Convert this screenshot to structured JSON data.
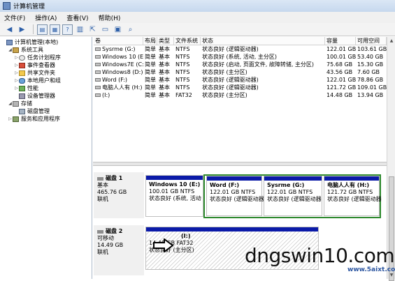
{
  "window": {
    "title": "计算机管理"
  },
  "menu": [
    "文件(F)",
    "操作(A)",
    "查看(V)",
    "帮助(H)"
  ],
  "toolbar": [
    {
      "icon": "back-arrow-icon",
      "glyph": "◀"
    },
    {
      "icon": "forward-arrow-icon",
      "glyph": "▶"
    },
    {
      "icon": "folder-up-icon",
      "glyph": "▤"
    },
    {
      "icon": "console-tree-icon",
      "glyph": "▦"
    },
    {
      "icon": "help-icon",
      "glyph": "?"
    },
    {
      "icon": "list-view-icon",
      "glyph": "▥"
    },
    {
      "icon": "export-icon",
      "glyph": "⇱"
    },
    {
      "icon": "folder-open-icon",
      "glyph": "▭"
    },
    {
      "icon": "properties-icon",
      "glyph": "▣"
    },
    {
      "icon": "search-icon",
      "glyph": "⌕"
    }
  ],
  "tree": [
    {
      "label": "计算机管理(本地)",
      "level": 0,
      "expander": "",
      "icon": "computer-icon",
      "cls": "comp"
    },
    {
      "label": "系统工具",
      "level": 1,
      "expander": "◢",
      "icon": "tools-icon",
      "cls": "tool"
    },
    {
      "label": "任务计划程序",
      "level": 2,
      "expander": "▷",
      "icon": "clock-icon",
      "cls": "clock"
    },
    {
      "label": "事件查看器",
      "level": 2,
      "expander": "▷",
      "icon": "event-log-icon",
      "cls": "log"
    },
    {
      "label": "共享文件夹",
      "level": 2,
      "expander": "▷",
      "icon": "shared-folder-icon",
      "cls": "folder"
    },
    {
      "label": "本地用户和组",
      "level": 2,
      "expander": "▷",
      "icon": "users-icon",
      "cls": "users"
    },
    {
      "label": "性能",
      "level": 2,
      "expander": "▷",
      "icon": "performance-icon",
      "cls": "perf"
    },
    {
      "label": "设备管理器",
      "level": 2,
      "expander": "",
      "icon": "device-manager-icon",
      "cls": "device"
    },
    {
      "label": "存储",
      "level": 1,
      "expander": "◢",
      "icon": "storage-icon",
      "cls": "store"
    },
    {
      "label": "磁盘管理",
      "level": 2,
      "expander": "",
      "icon": "disk-management-icon",
      "cls": "disk"
    },
    {
      "label": "服务和应用程序",
      "level": 1,
      "expander": "▷",
      "icon": "services-icon",
      "cls": "svc"
    }
  ],
  "columns": [
    "卷",
    "布局",
    "类型",
    "文件系统",
    "状态",
    "容量",
    "可用空间"
  ],
  "volumes": [
    [
      "Sysrme (G:)",
      "简单",
      "基本",
      "NTFS",
      "状态良好 (逻辑驱动器)",
      "122.01 GB",
      "103.61 GB"
    ],
    [
      "Windows 10 (E:)",
      "简单",
      "基本",
      "NTFS",
      "状态良好 (系统, 活动, 主分区)",
      "100.01 GB",
      "53.40 GB"
    ],
    [
      "Windows7E (C:)",
      "简单",
      "基本",
      "NTFS",
      "状态良好 (启动, 页面文件, 故障转储, 主分区)",
      "75.68 GB",
      "15.30 GB"
    ],
    [
      "Windows8 (D:)",
      "简单",
      "基本",
      "NTFS",
      "状态良好 (主分区)",
      "43.56 GB",
      "7.60 GB"
    ],
    [
      "Word (F:)",
      "简单",
      "基本",
      "NTFS",
      "状态良好 (逻辑驱动器)",
      "122.01 GB",
      "78.86 GB"
    ],
    [
      "电脑人人有 (H:)",
      "简单",
      "基本",
      "NTFS",
      "状态良好 (逻辑驱动器)",
      "121.72 GB",
      "109.01 GB"
    ],
    [
      "(I:)",
      "简单",
      "基本",
      "FAT32",
      "状态良好 (主分区)",
      "14.48 GB",
      "13.94 GB"
    ]
  ],
  "disks": [
    {
      "name": "磁盘 1",
      "type": "基本",
      "size": "465.76 GB",
      "status": "联机",
      "partitions": [
        {
          "name": "Windows 10  (E:)",
          "fs": "100.01 GB NTFS",
          "status": "状态良好 (系统, 活动"
        },
        {
          "name": "Word  (F:)",
          "fs": "122.01 GB NTFS",
          "status": "状态良好 (逻辑驱动器"
        },
        {
          "name": "Sysrme  (G:)",
          "fs": "122.01 GB NTFS",
          "status": "状态良好 (逻辑驱动器"
        },
        {
          "name": "电脑人人有  (H:)",
          "fs": "121.72 GB NTFS",
          "status": "状态良好 (逻辑驱动器"
        }
      ]
    },
    {
      "name": "磁盘 2",
      "type": "可移动",
      "size": "14.49 GB",
      "status": "联机",
      "partitions": [
        {
          "name": "(I:)",
          "fs": "14.48 GB FAT32",
          "status": "状态良好 (主分区)"
        }
      ]
    }
  ],
  "watermark": {
    "text": "dngswin10.com",
    "sub": "www.5aixt.com"
  }
}
